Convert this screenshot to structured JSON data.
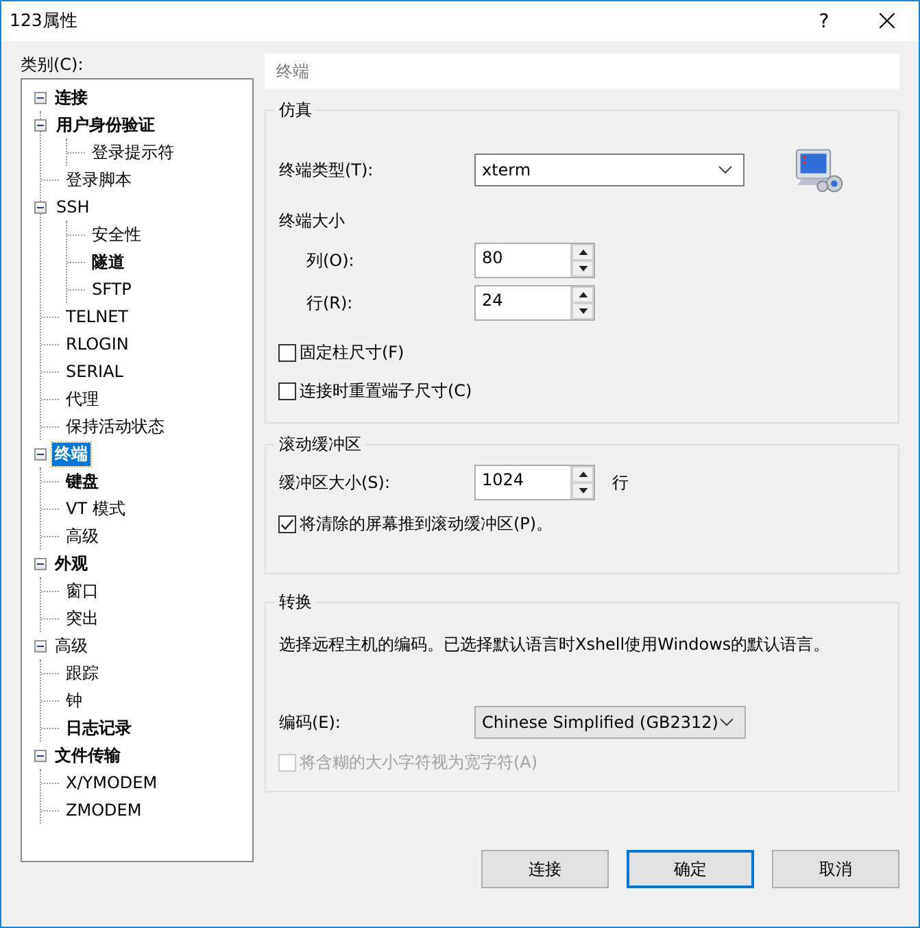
{
  "window": {
    "title": "123属性",
    "help": "?",
    "close": "×"
  },
  "category_label": "类别(C):",
  "tree": [
    {
      "label": "连接",
      "bold": true,
      "selected": false,
      "expanded": true,
      "children": [
        {
          "label": "用户身份验证",
          "bold": true,
          "selected": false,
          "expanded": true,
          "children": [
            {
              "label": "登录提示符",
              "bold": false,
              "selected": false
            }
          ]
        },
        {
          "label": "登录脚本",
          "bold": false,
          "selected": false
        },
        {
          "label": "SSH",
          "bold": false,
          "selected": false,
          "expanded": true,
          "children": [
            {
              "label": "安全性",
              "bold": false,
              "selected": false
            },
            {
              "label": "隧道",
              "bold": true,
              "selected": false
            },
            {
              "label": "SFTP",
              "bold": false,
              "selected": false
            }
          ]
        },
        {
          "label": "TELNET",
          "bold": false,
          "selected": false
        },
        {
          "label": "RLOGIN",
          "bold": false,
          "selected": false
        },
        {
          "label": "SERIAL",
          "bold": false,
          "selected": false
        },
        {
          "label": "代理",
          "bold": false,
          "selected": false
        },
        {
          "label": "保持活动状态",
          "bold": false,
          "selected": false
        }
      ]
    },
    {
      "label": "终端",
      "bold": true,
      "selected": true,
      "expanded": true,
      "children": [
        {
          "label": "键盘",
          "bold": true,
          "selected": false
        },
        {
          "label": "VT 模式",
          "bold": false,
          "selected": false
        },
        {
          "label": "高级",
          "bold": false,
          "selected": false
        }
      ]
    },
    {
      "label": "外观",
      "bold": true,
      "selected": false,
      "expanded": true,
      "children": [
        {
          "label": "窗口",
          "bold": false,
          "selected": false
        },
        {
          "label": "突出",
          "bold": false,
          "selected": false
        }
      ]
    },
    {
      "label": "高级",
      "bold": false,
      "selected": false,
      "expanded": true,
      "children": [
        {
          "label": "跟踪",
          "bold": false,
          "selected": false
        },
        {
          "label": "钟",
          "bold": false,
          "selected": false
        },
        {
          "label": "日志记录",
          "bold": true,
          "selected": false
        }
      ]
    },
    {
      "label": "文件传输",
      "bold": true,
      "selected": false,
      "expanded": true,
      "children": [
        {
          "label": "X/YMODEM",
          "bold": false,
          "selected": false
        },
        {
          "label": "ZMODEM",
          "bold": false,
          "selected": false
        }
      ]
    }
  ],
  "page_title": "终端",
  "emulation": {
    "title": "仿真",
    "terminal_type_label": "终端类型(T):",
    "terminal_type": "xterm",
    "size_label": "终端大小",
    "columns_label": "列(O):",
    "columns": "80",
    "rows_label": "行(R):",
    "rows": "24",
    "checkboxes": [
      {
        "label": "固定柱尺寸(F)",
        "checked": false,
        "disabled": false
      },
      {
        "label": "连接时重置端子尺寸(C)",
        "checked": false,
        "disabled": false
      }
    ]
  },
  "scrollback": {
    "title": "滚动缓冲区",
    "size_label": "缓冲区大小(S):",
    "size": "1024",
    "unit": "行",
    "checkboxes": [
      {
        "label": "将清除的屏幕推到滚动缓冲区(P)。",
        "checked": true,
        "disabled": false
      }
    ]
  },
  "translation": {
    "title": "转换",
    "description": "选择远程主机的编码。已选择默认语言时Xshell使用Windows的默认语言。",
    "encoding_label": "编码(E):",
    "encoding": "Chinese Simplified (GB2312)",
    "checkboxes": [
      {
        "label": "将含糊的大小字符视为宽字符(A)",
        "checked": false,
        "disabled": true
      }
    ]
  },
  "buttons": [
    {
      "label": "连接",
      "default": false
    },
    {
      "label": "确定",
      "default": true
    },
    {
      "label": "取消",
      "default": false
    }
  ]
}
